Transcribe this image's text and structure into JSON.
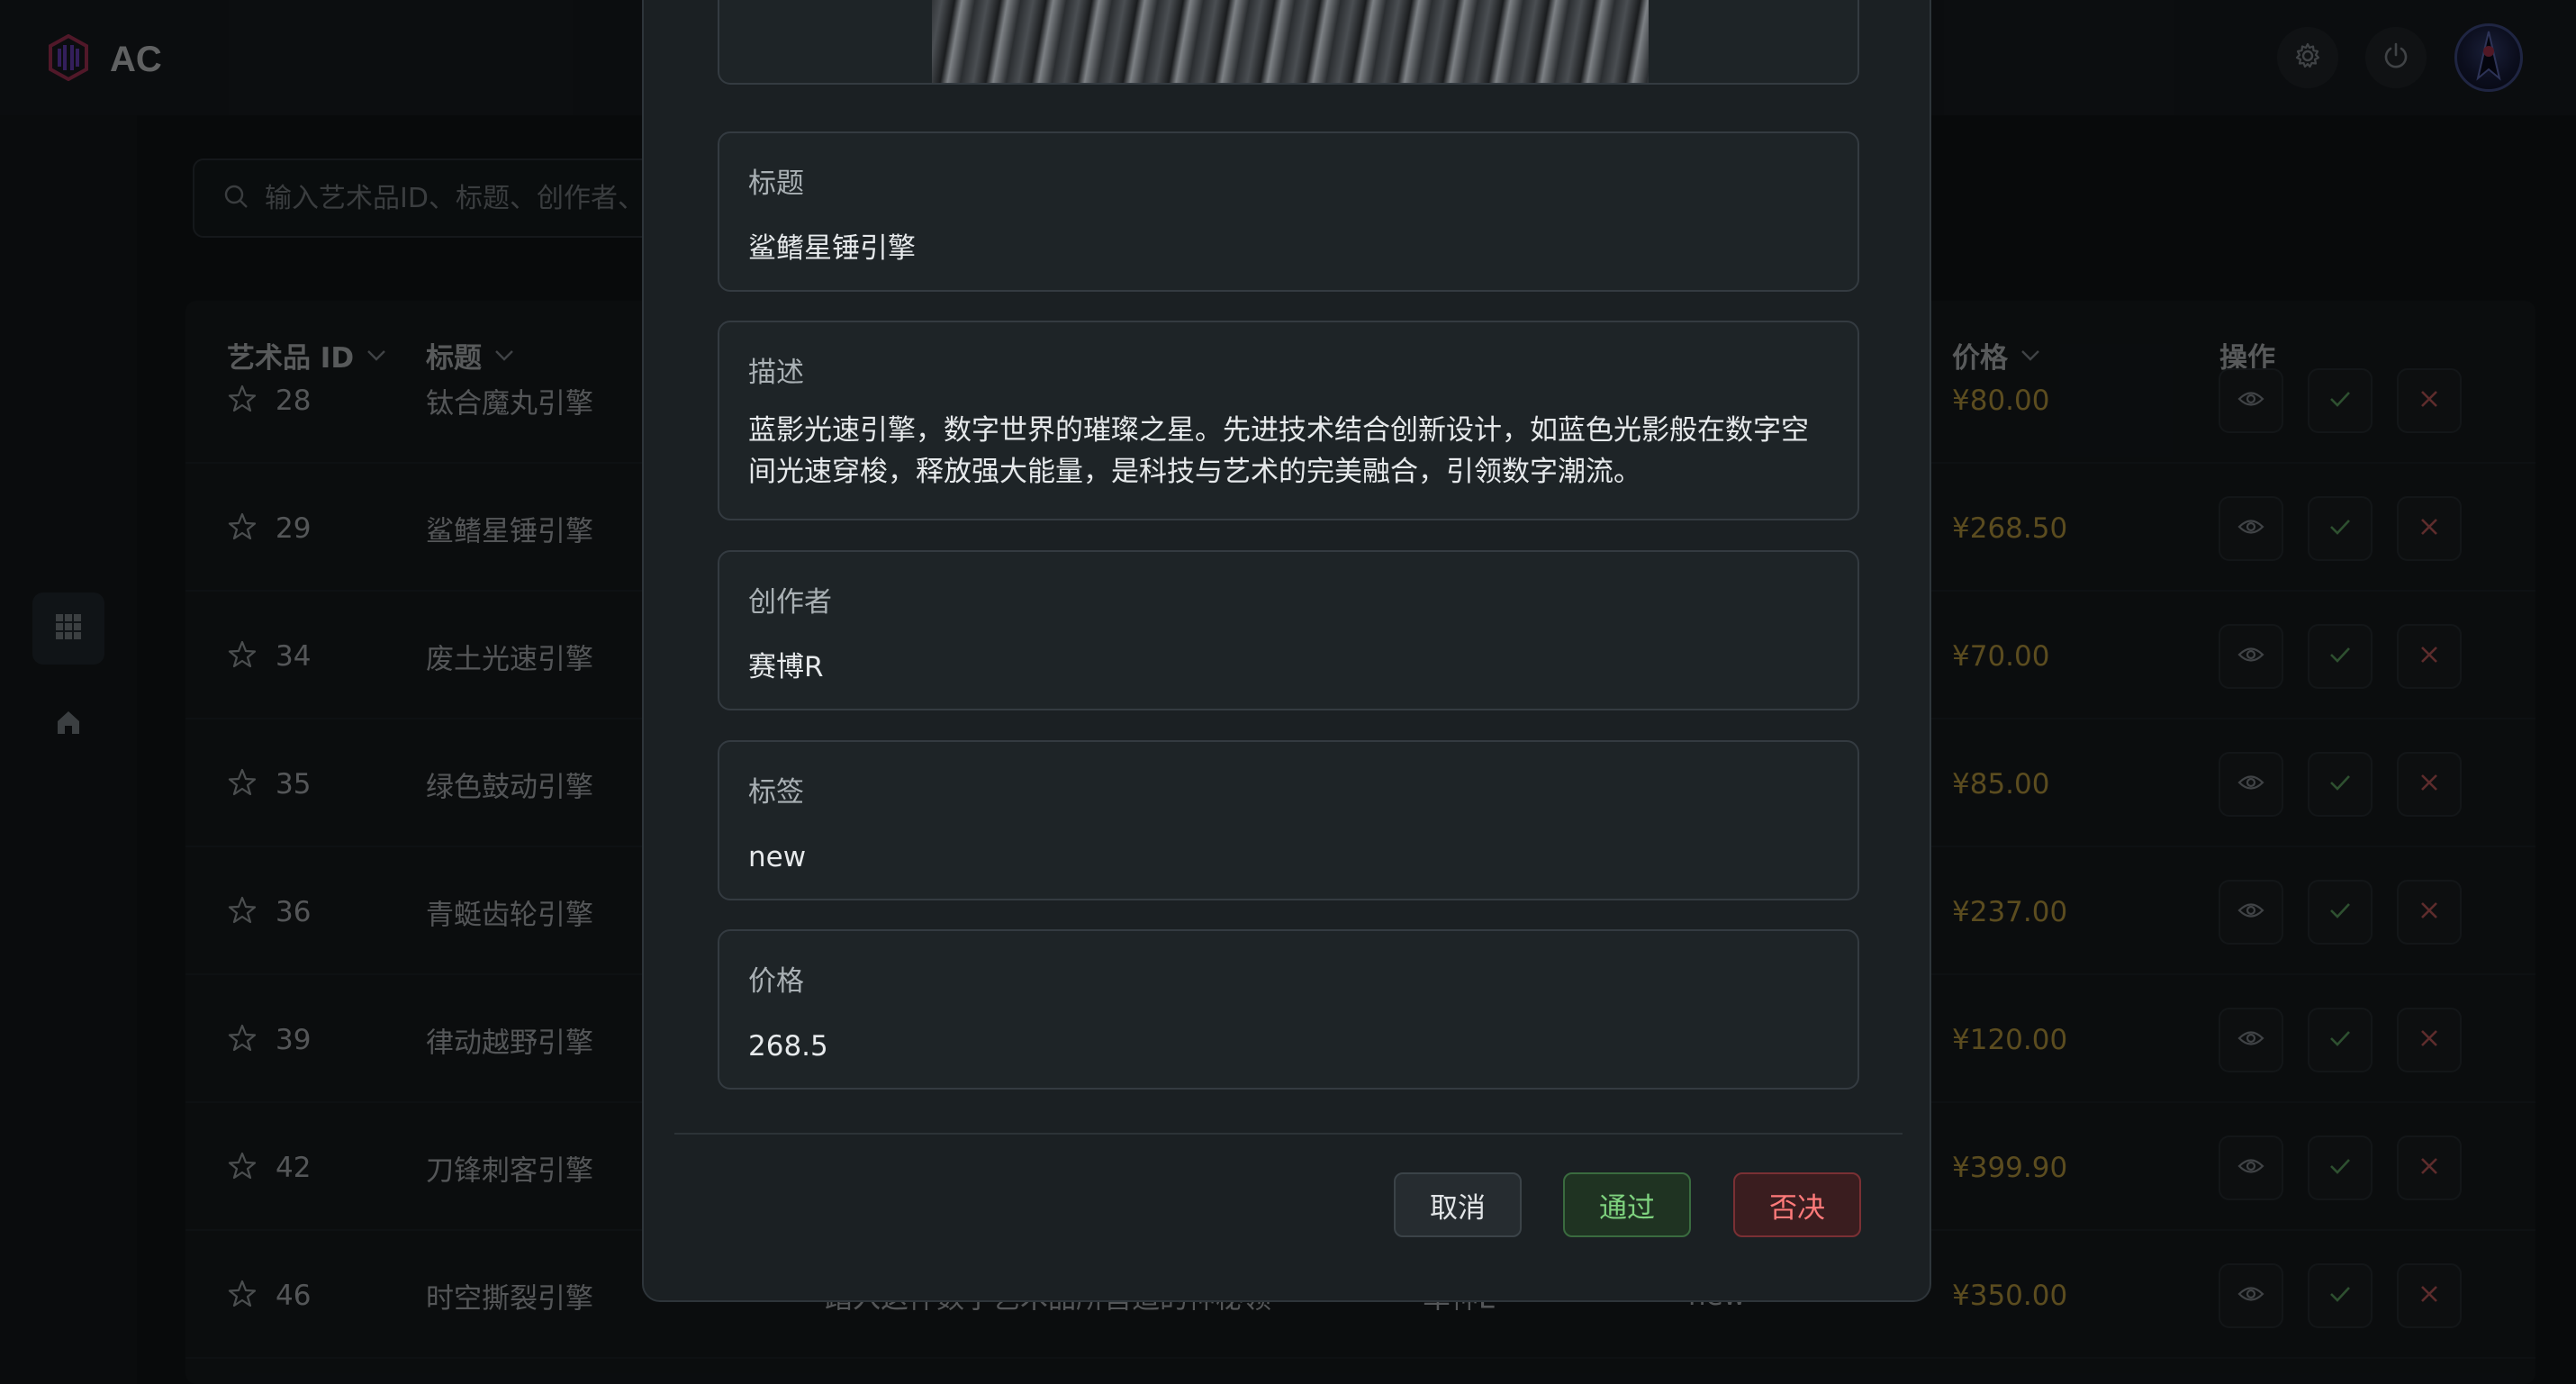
{
  "app": {
    "logo_text": "AC"
  },
  "search": {
    "placeholder": "输入艺术品ID、标题、创作者、"
  },
  "table": {
    "headers": {
      "id": "艺术品 ID",
      "title": "标题",
      "price": "价格",
      "actions": "操作"
    },
    "rows": [
      {
        "id": "28",
        "title": "钛合魔丸引擎",
        "price": "¥80.00"
      },
      {
        "id": "29",
        "title": "鲨鳍星锤引擎",
        "price": "¥268.50"
      },
      {
        "id": "34",
        "title": "废土光速引擎",
        "price": "¥70.00"
      },
      {
        "id": "35",
        "title": "绿色鼓动引擎",
        "price": "¥85.00"
      },
      {
        "id": "36",
        "title": "青蜓齿轮引擎",
        "price": "¥237.00"
      },
      {
        "id": "39",
        "title": "律动越野引擎",
        "price": "¥120.00"
      },
      {
        "id": "42",
        "title": "刀锋刺客引擎",
        "price": "¥399.90"
      },
      {
        "id": "46",
        "title": "时空撕裂引擎",
        "description": "踏入这件数字艺术品所营造的神秘领",
        "creator": "车神E",
        "tags": "new",
        "price": "¥350.00"
      }
    ]
  },
  "modal": {
    "fields": [
      {
        "label": "标题",
        "value": "鲨鳍星锤引擎"
      },
      {
        "label": "描述",
        "value": "蓝影光速引擎，数字世界的璀璨之星。先进技术结合创新设计，如蓝色光影般在数字空间光速穿梭，释放强大能量，是科技与艺术的完美融合，引领数字潮流。"
      },
      {
        "label": "创作者",
        "value": "赛博R"
      },
      {
        "label": "标签",
        "value": "new"
      },
      {
        "label": "价格",
        "value": "268.5"
      }
    ],
    "buttons": {
      "cancel": "取消",
      "approve": "通过",
      "reject": "否决"
    }
  },
  "colors": {
    "accent_approve": "#7fd37f",
    "accent_reject": "#ff7a7a",
    "price": "#d9b54a"
  }
}
